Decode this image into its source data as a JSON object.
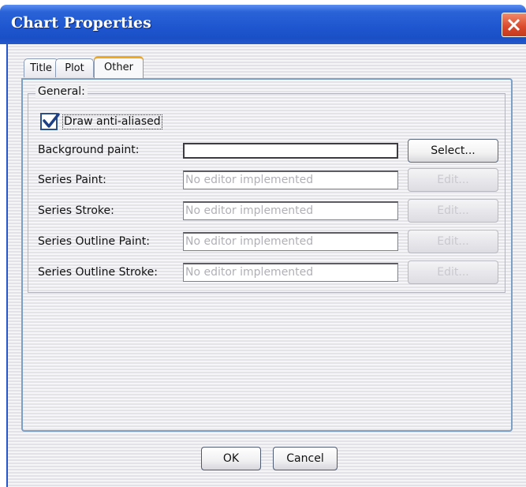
{
  "window": {
    "title": "Chart Properties"
  },
  "tabs": [
    {
      "label": "Title"
    },
    {
      "label": "Plot"
    },
    {
      "label": "Other",
      "selected": true
    }
  ],
  "general": {
    "group_label": "General:",
    "anti_aliased": {
      "label": "Draw anti-aliased",
      "checked": true
    },
    "rows": [
      {
        "label": "Background paint:",
        "value": "",
        "button": "Select...",
        "button_enabled": true
      },
      {
        "label": "Series Paint:",
        "value": "No editor implemented",
        "button": "Edit...",
        "button_enabled": false
      },
      {
        "label": "Series Stroke:",
        "value": "No editor implemented",
        "button": "Edit...",
        "button_enabled": false
      },
      {
        "label": "Series Outline Paint:",
        "value": "No editor implemented",
        "button": "Edit...",
        "button_enabled": false
      },
      {
        "label": "Series Outline Stroke:",
        "value": "No editor implemented",
        "button": "Edit...",
        "button_enabled": false
      }
    ]
  },
  "footer": {
    "ok_label": "OK",
    "cancel_label": "Cancel"
  },
  "colors": {
    "titlebar": "#1f57d0",
    "close_button": "#d9482a",
    "selected_tab_accent": "#f0a820",
    "panel_border": "#7c9fc6"
  }
}
